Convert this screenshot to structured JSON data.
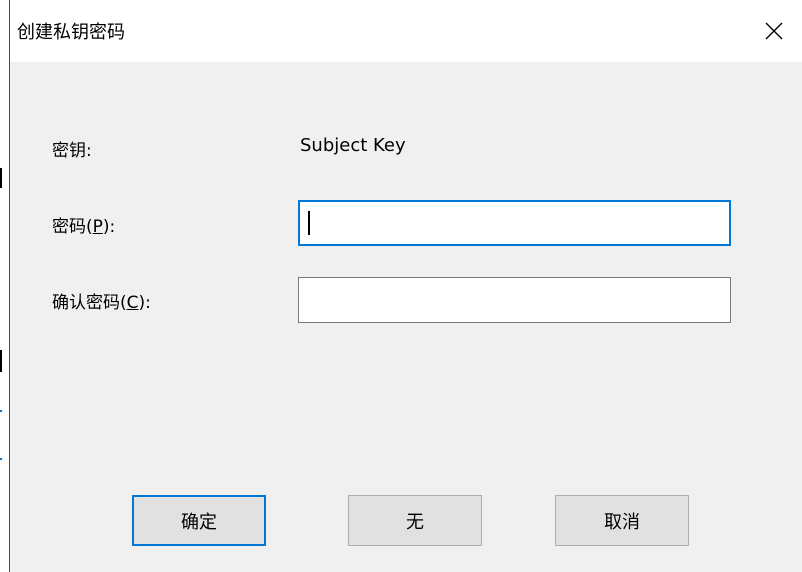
{
  "dialog": {
    "title": "创建私钥密码",
    "close_icon": "close-icon"
  },
  "form": {
    "key_label": "密钥:",
    "key_value": "Subject Key",
    "password_label_prefix": "密码(",
    "password_label_mnemonic": "P",
    "password_label_suffix": "):",
    "password_value": "",
    "confirm_label_prefix": "确认密码(",
    "confirm_label_mnemonic": "C",
    "confirm_label_suffix": "):",
    "confirm_value": ""
  },
  "buttons": {
    "ok": "确定",
    "none": "无",
    "cancel": "取消"
  },
  "colors": {
    "focus_accent": "#0078d7",
    "dialog_bg": "#f0f0f0"
  }
}
